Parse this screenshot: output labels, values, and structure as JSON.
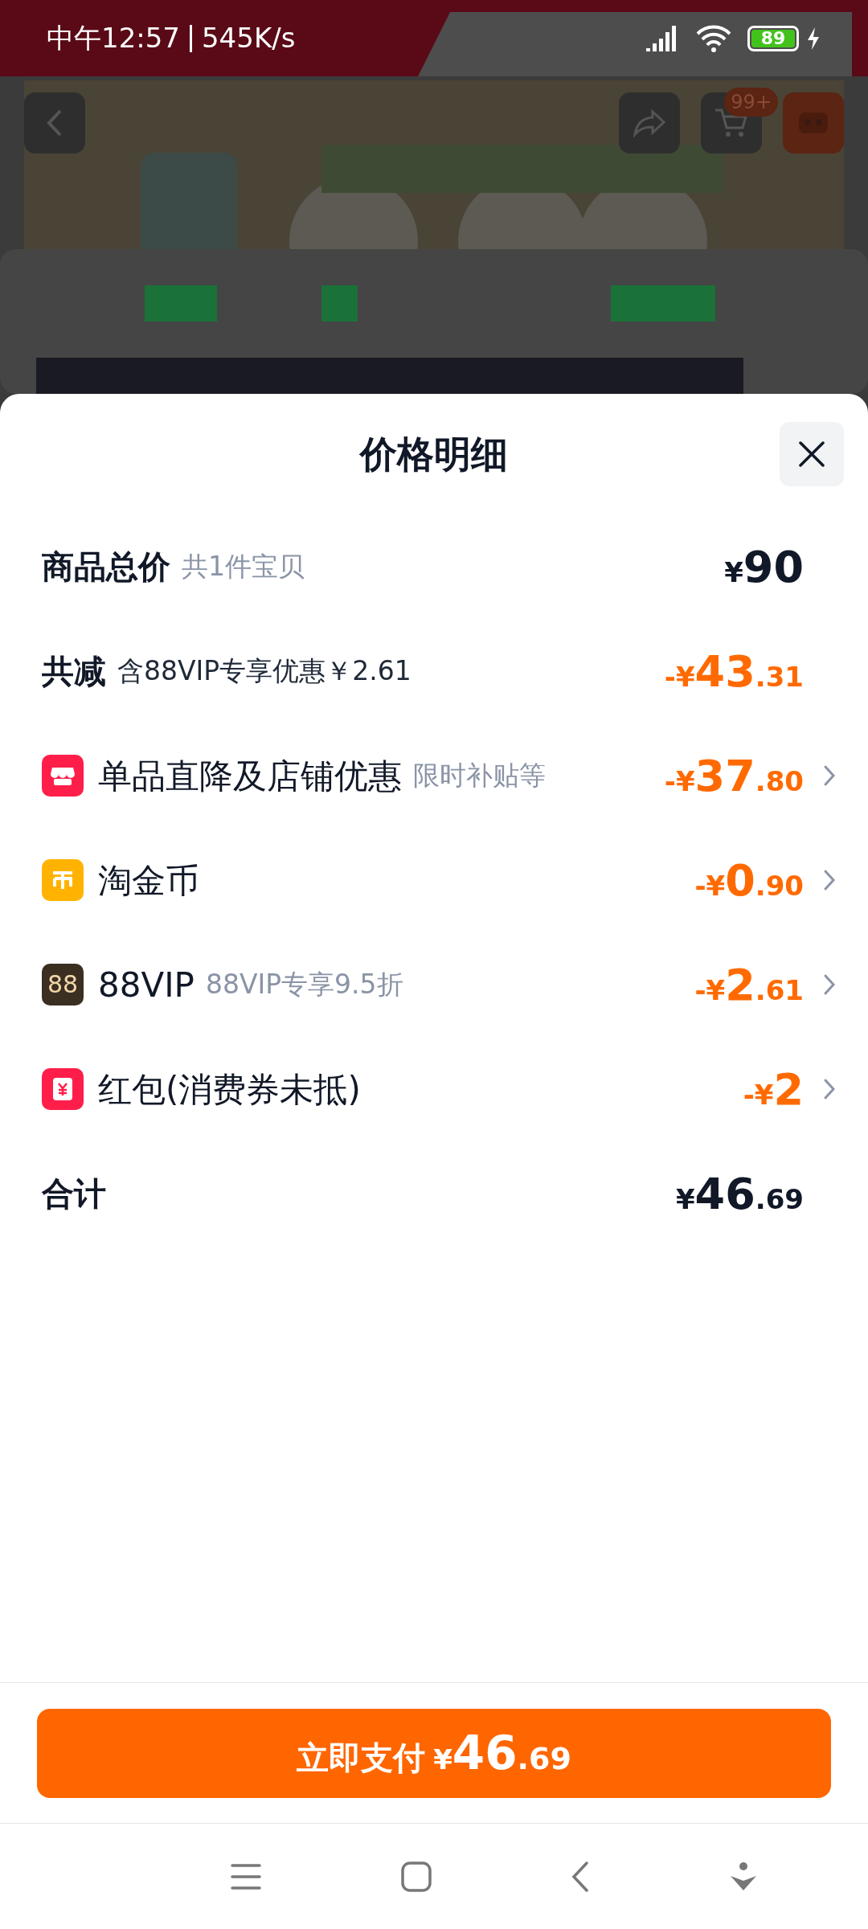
{
  "status_bar": {
    "time": "中午12:57",
    "speed": "545K/s",
    "battery": "89"
  },
  "background_page": {
    "cart_badge": "99+"
  },
  "sheet": {
    "title": "价格明细"
  },
  "rows": [
    {
      "kind": "subtotal",
      "label": "商品总价",
      "note": "共1件宝贝",
      "sign": "¥",
      "integer": "90",
      "decimal": ""
    },
    {
      "kind": "savings",
      "label": "共减",
      "note": "含88VIP专享优惠￥2.61",
      "sign": "-¥",
      "integer": "43",
      "decimal": ".31"
    },
    {
      "kind": "shop",
      "label": "单品直降及店铺优惠",
      "note": "限时补贴等",
      "sign": "-¥",
      "integer": "37",
      "decimal": ".80"
    },
    {
      "kind": "coin",
      "label": "淘金币",
      "note": "",
      "sign": "-¥",
      "integer": "0",
      "decimal": ".90"
    },
    {
      "kind": "vip",
      "icon_text": "88",
      "label": "88VIP",
      "note": "88VIP专享9.5折",
      "sign": "-¥",
      "integer": "2",
      "decimal": ".61"
    },
    {
      "kind": "redpacket",
      "label": "红包(消费券未抵)",
      "note": "",
      "sign": "-¥",
      "integer": "2",
      "decimal": ""
    },
    {
      "kind": "total",
      "label": "合计",
      "note": "",
      "sign": "¥",
      "integer": "46",
      "decimal": ".69"
    }
  ],
  "pay_button": {
    "label": "立即支付",
    "sign": "¥",
    "integer": "46",
    "decimal": ".69"
  }
}
